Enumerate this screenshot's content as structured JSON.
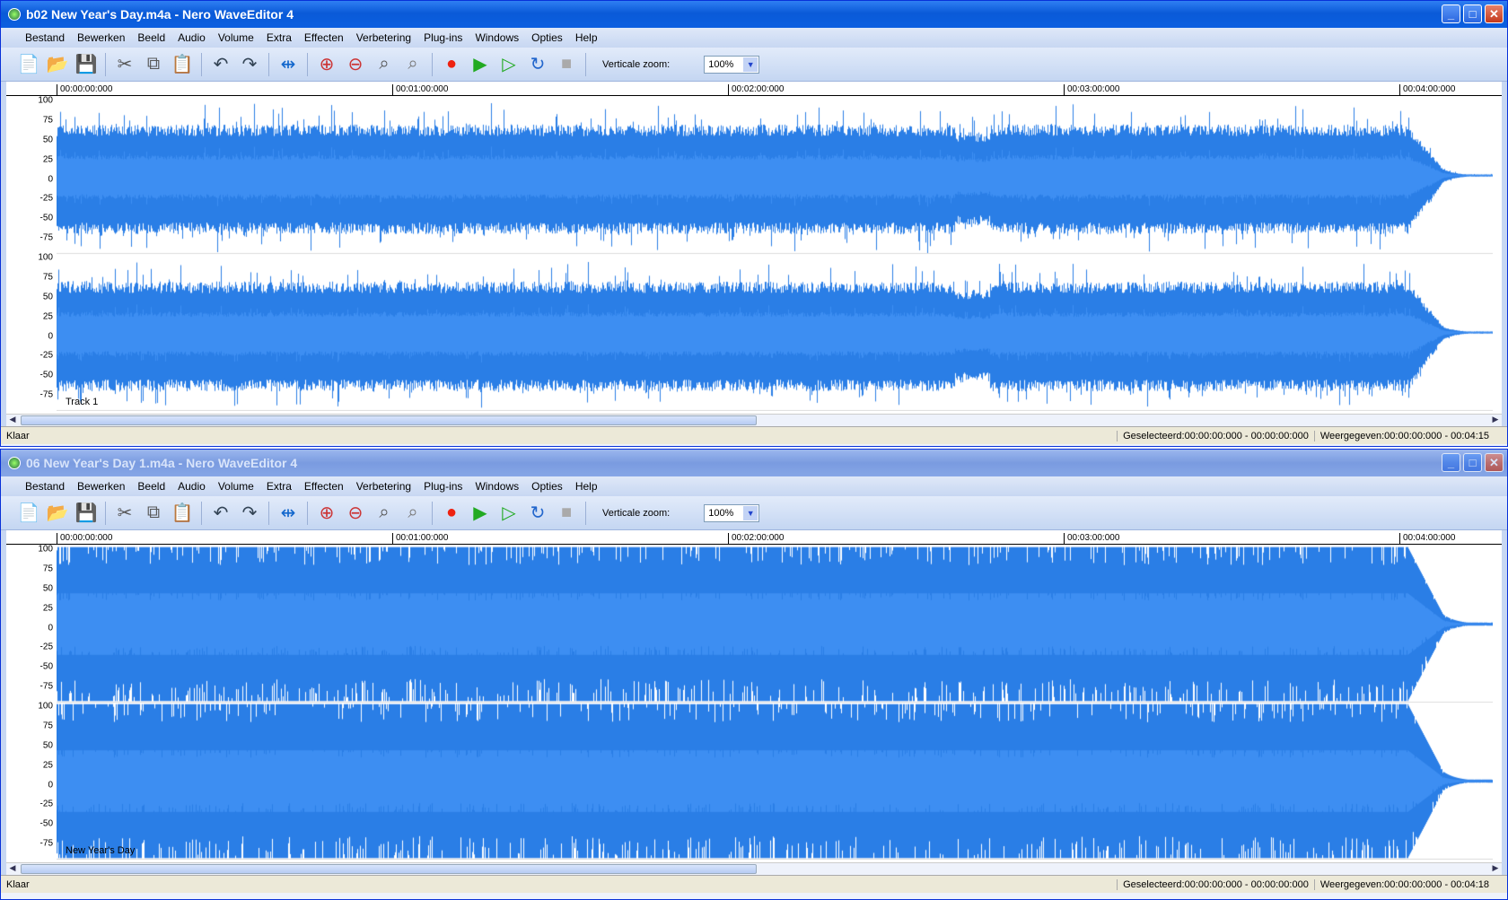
{
  "windows": [
    {
      "title": "b02 New Year's Day.m4a - Nero WaveEditor 4",
      "active": true,
      "track_label": "Track 1",
      "status": "Klaar",
      "selected": "Geselecteerd:00:00:00:000 - 00:00:00:000",
      "shown": "Weergegeven:00:00:00:000 - 00:04:15",
      "clipped": false
    },
    {
      "title": "06 New Year's Day 1.m4a - Nero WaveEditor 4",
      "active": false,
      "track_label": "New Year's Day",
      "status": "Klaar",
      "selected": "Geselecteerd:00:00:00:000 - 00:00:00:000",
      "shown": "Weergegeven:00:00:00:000 - 00:04:18",
      "clipped": true
    }
  ],
  "menu": [
    "Bestand",
    "Bewerken",
    "Beeld",
    "Audio",
    "Volume",
    "Extra",
    "Effecten",
    "Verbetering",
    "Plug-ins",
    "Windows",
    "Opties",
    "Help"
  ],
  "toolbar": {
    "zoom_label": "Verticale zoom:",
    "zoom_value": "100%",
    "icons": [
      "new-file",
      "open-file",
      "save",
      "|",
      "cut",
      "copy",
      "paste",
      "|",
      "undo",
      "redo",
      "|",
      "fit-width",
      "|",
      "zoom-in",
      "zoom-out",
      "zoom-selection",
      "zoom-full",
      "|",
      "record",
      "play",
      "play-selection",
      "loop",
      "stop"
    ]
  },
  "ruler": [
    "00:00:00:000",
    "00:01:00:000",
    "00:02:00:000",
    "00:03:00:000",
    "00:04:00:000"
  ],
  "amplitude_ticks": [
    "100",
    "75",
    "50",
    "25",
    "0",
    "-25",
    "-50",
    "-75"
  ],
  "colors": {
    "wave": "#2a7ee6",
    "wave_light": "#3d8ef2"
  }
}
